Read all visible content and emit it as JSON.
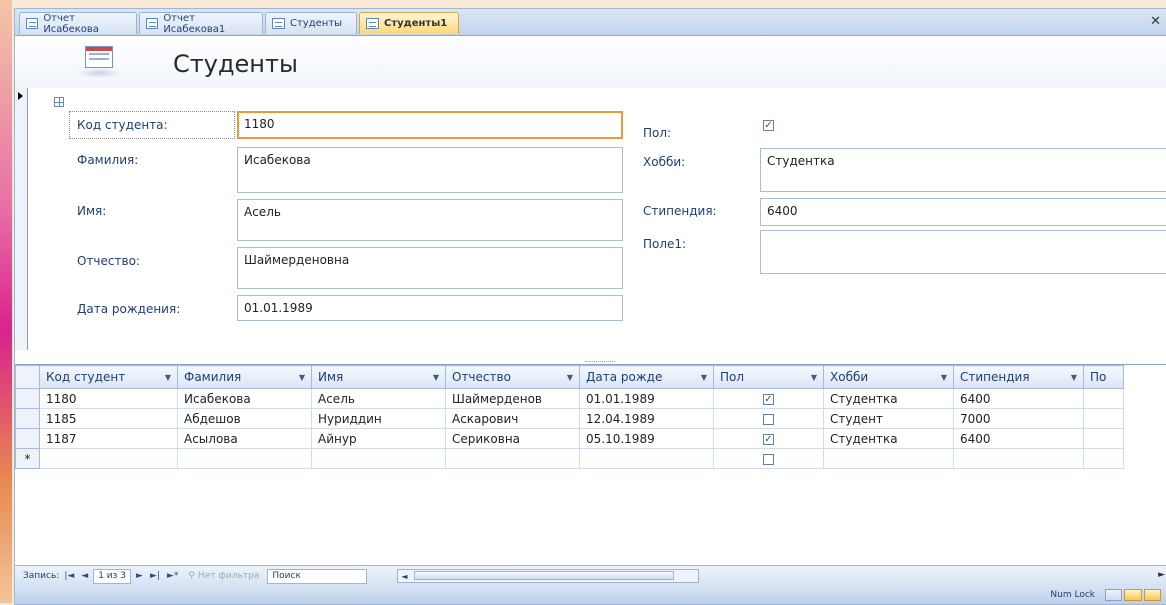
{
  "tabs": [
    {
      "label": "Отчет Исабекова",
      "active": false
    },
    {
      "label": "Отчет Исабекова1",
      "active": false
    },
    {
      "label": "Студенты",
      "active": false
    },
    {
      "label": "Студенты1",
      "active": true
    }
  ],
  "form": {
    "title": "Студенты",
    "fields": {
      "code_label": "Код студента:",
      "code_value": "1180",
      "lastname_label": "Фамилия:",
      "lastname_value": "Исабекова",
      "firstname_label": "Имя:",
      "firstname_value": "Асель",
      "patronymic_label": "Отчество:",
      "patronymic_value": "Шаймерденовна",
      "birthdate_label": "Дата рождения:",
      "birthdate_value": "01.01.1989",
      "gender_label": "Пол:",
      "gender_checked": true,
      "hobby_label": "Хобби:",
      "hobby_value": "Студентка",
      "stipend_label": "Стипендия:",
      "stipend_value": "6400",
      "field1_label": "Поле1:",
      "field1_value": ""
    }
  },
  "datasheet": {
    "columns": [
      "Код студент",
      "Фамилия",
      "Имя",
      "Отчество",
      "Дата рожде",
      "Пол",
      "Хобби",
      "Стипендия",
      "По"
    ],
    "rows": [
      {
        "code": "1180",
        "lastname": "Исабекова",
        "firstname": "Асель",
        "patronymic": "Шаймерденов",
        "birth": "01.01.1989",
        "gender": true,
        "hobby": "Студентка",
        "stipend": "6400"
      },
      {
        "code": "1185",
        "lastname": "Абдешов",
        "firstname": "Нуриддин",
        "patronymic": "Аскарович",
        "birth": "12.04.1989",
        "gender": false,
        "hobby": "Студент",
        "stipend": "7000"
      },
      {
        "code": "1187",
        "lastname": "Асылова",
        "firstname": "Айнур",
        "patronymic": "Сериковна",
        "birth": "05.10.1989",
        "gender": true,
        "hobby": "Студентка",
        "stipend": "6400"
      }
    ]
  },
  "navbar": {
    "record_label": "Запись:",
    "record_position": "1 из 3",
    "filter_label": "Нет фильтра",
    "search_label": "Поиск"
  },
  "status": {
    "numlock": "Num Lock"
  },
  "icons": {
    "close": "close-icon",
    "tab": "form-tab-icon",
    "checkbox": "checkbox-icon"
  }
}
